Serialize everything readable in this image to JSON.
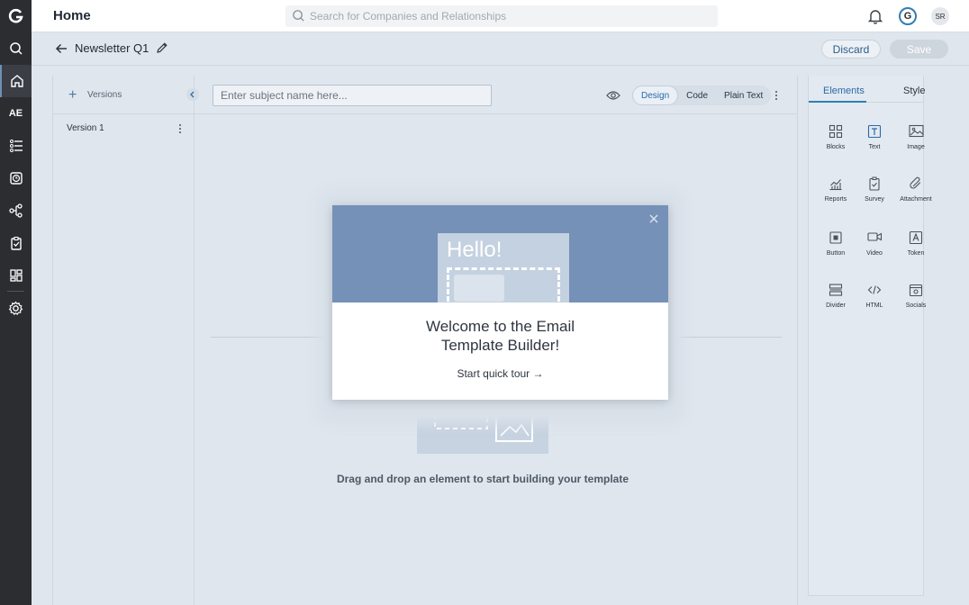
{
  "header": {
    "title": "Home",
    "search_placeholder": "Search for Companies and Relationships",
    "avatar_initials": "SR",
    "logo_letter": "G"
  },
  "rail": {
    "ae_label": "AE",
    "icons": [
      "search-icon",
      "home-icon",
      "ae-label",
      "list-icon",
      "clock-icon",
      "workflow-icon",
      "clipboard-icon",
      "dashboard-icon",
      "settings-icon"
    ]
  },
  "subheader": {
    "doc_name": "Newsletter Q1",
    "discard_label": "Discard",
    "save_label": "Save"
  },
  "versions": {
    "header_label": "Versions",
    "items": [
      {
        "label": "Version 1"
      }
    ]
  },
  "editor": {
    "subject_placeholder": "Enter subject name here...",
    "modes": [
      {
        "label": "Design",
        "active": true
      },
      {
        "label": "Code",
        "active": false
      },
      {
        "label": "Plain Text",
        "active": false
      }
    ],
    "drag_text": "Drag and drop an element to start building your template"
  },
  "panel": {
    "tabs": [
      {
        "label": "Elements",
        "active": true
      },
      {
        "label": "Style",
        "active": false
      }
    ],
    "elements": [
      {
        "label": "Blocks",
        "icon": "blocks-icon"
      },
      {
        "label": "Text",
        "icon": "text-icon"
      },
      {
        "label": "Image",
        "icon": "image-icon"
      },
      {
        "label": "Reports",
        "icon": "reports-icon"
      },
      {
        "label": "Survey",
        "icon": "survey-icon"
      },
      {
        "label": "Attachment",
        "icon": "attachment-icon"
      },
      {
        "label": "Button",
        "icon": "button-icon"
      },
      {
        "label": "Video",
        "icon": "video-icon"
      },
      {
        "label": "Token",
        "icon": "token-icon"
      },
      {
        "label": "Divider",
        "icon": "divider-icon"
      },
      {
        "label": "HTML",
        "icon": "html-icon"
      },
      {
        "label": "Socials",
        "icon": "socials-icon"
      }
    ]
  },
  "modal": {
    "hero_text": "Hello!",
    "title_line1": "Welcome to the Email",
    "title_line2": "Template Builder!",
    "tour_label": "Start quick tour",
    "tour_arrow": "→"
  },
  "colors": {
    "accent": "#2f7fb5",
    "rail_bg": "#2b2d31",
    "hero_bg": "#7591b8"
  }
}
